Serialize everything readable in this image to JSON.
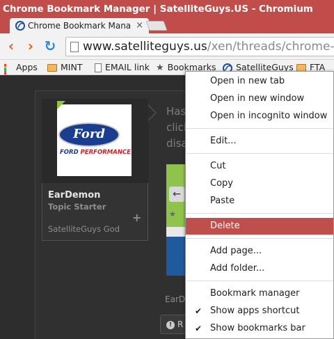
{
  "window": {
    "title": "Chrome Bookmark Manager | SatelliteGuys.US - Chromium"
  },
  "tab": {
    "label": "Chrome Bookmark Mana",
    "close": "×"
  },
  "omnibox": {
    "host": "www.satelliteguys.us",
    "path": "/xen/threads/chrome-book"
  },
  "nav": {
    "back": "‹",
    "forward": "›",
    "reload": "↻"
  },
  "bookmarks": [
    {
      "label": "Apps",
      "icon": "apps-grid-icon"
    },
    {
      "label": "MINT",
      "icon": "folder-icon"
    },
    {
      "label": "EMAIL link",
      "icon": "page-icon"
    },
    {
      "label": "Bookmarks",
      "icon": "star-icon"
    },
    {
      "label": "SatelliteGuys",
      "icon": "site-favicon-icon"
    },
    {
      "label": "FTA",
      "icon": "folder-icon"
    }
  ],
  "post": {
    "user": {
      "name": "EarDemon",
      "title": "Topic Starter",
      "rank": "SatelliteGuys God",
      "avatar_brand": "Ford",
      "avatar_caption_a": "FORD ",
      "avatar_caption_b": "PERFORMANCE"
    },
    "text_lines": [
      "Has",
      "click",
      "disa"
    ],
    "author_fragment": "EarD",
    "report_label": "R",
    "plus": "+"
  },
  "context_menu": {
    "items": [
      {
        "label": "Open in new tab"
      },
      {
        "label": "Open in new window"
      },
      {
        "label": "Open in incognito window"
      },
      {
        "label": "Edit..."
      },
      {
        "label": "Cut"
      },
      {
        "label": "Copy"
      },
      {
        "label": "Paste"
      },
      {
        "label": "Delete",
        "highlighted": true
      },
      {
        "label": "Add page..."
      },
      {
        "label": "Add folder..."
      },
      {
        "label": "Bookmark manager"
      },
      {
        "label": "Show apps shortcut",
        "checked": true
      },
      {
        "label": "Show bookmarks bar",
        "checked": true
      }
    ],
    "check_mark": "✔"
  },
  "colors": {
    "titlebar": "#c04d49",
    "menu_highlight": "#bf4f4c",
    "accent_green": "#8cc63f"
  }
}
